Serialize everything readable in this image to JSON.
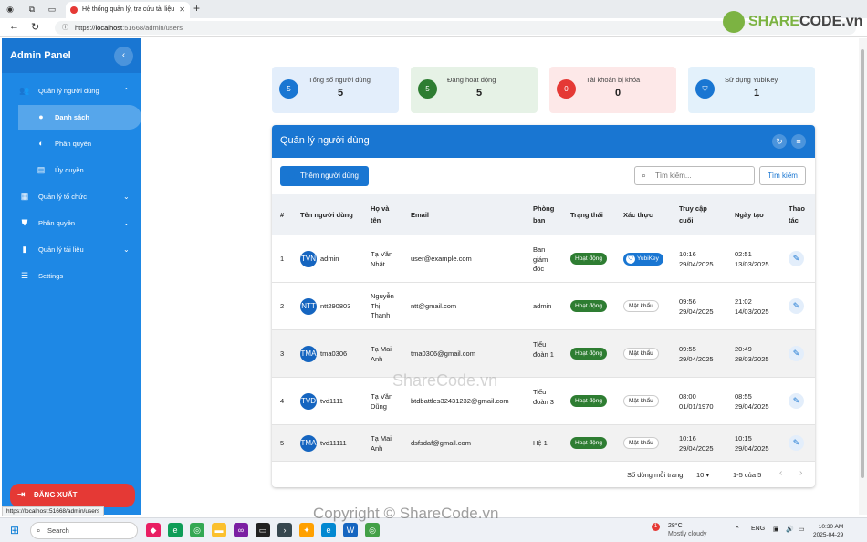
{
  "browser": {
    "tab_title": "Hệ thống quản lý, tra cứu tài liệu",
    "url_host": "localhost",
    "url_path": ":51668/admin/users",
    "status_url": "https://localhost:51668/admin/users"
  },
  "sidebar": {
    "title": "Admin Panel",
    "items": [
      {
        "label": "Quản lý người dùng",
        "icon": "users-icon",
        "expanded": true
      },
      {
        "label": "Danh sách",
        "icon": "account-circle-icon",
        "active": true
      },
      {
        "label": "Phân quyền",
        "icon": "account-settings-icon"
      },
      {
        "label": "Ủy quyền",
        "icon": "clipboard-icon"
      },
      {
        "label": "Quản lý tổ chức",
        "icon": "building-icon"
      },
      {
        "label": "Phân quyền",
        "icon": "shield-icon"
      },
      {
        "label": "Quản lý tài liệu",
        "icon": "document-icon"
      },
      {
        "label": "Settings",
        "icon": "sliders-icon"
      }
    ],
    "logout_label": "ĐĂNG XUẤT"
  },
  "stats": [
    {
      "label": "Tổng số người dùng",
      "value": "5",
      "badge": "5",
      "color": "#1976d2",
      "bg": "#e3eefb"
    },
    {
      "label": "Đang hoạt động",
      "value": "5",
      "badge": "5",
      "color": "#2e7d32",
      "bg": "#e6f2e6"
    },
    {
      "label": "Tài khoản bị khóa",
      "value": "0",
      "badge": "0",
      "color": "#e53935",
      "bg": "#fde8e8"
    },
    {
      "label": "Sử dụng YubiKey",
      "value": "1",
      "badge": "",
      "color": "#1976d2",
      "bg": "#e3f1fb"
    }
  ],
  "card": {
    "title": "Quản lý người dùng",
    "add_button": "Thêm người dùng",
    "search_placeholder": "Tìm kiếm...",
    "search_button": "Tìm kiếm"
  },
  "table": {
    "headers": [
      "#",
      "Tên người dùng",
      "Họ và tên",
      "Email",
      "Phòng ban",
      "Trạng thái",
      "Xác thực",
      "Truy cập cuối",
      "Ngày tạo",
      "Thao tác"
    ],
    "rows": [
      {
        "num": "1",
        "avatar": "TVN",
        "username": "admin",
        "fullname": "Tạ Văn Nhật",
        "email": "user@example.com",
        "dept": "Ban giám đốc",
        "status": "Hoạt động",
        "auth": "YubiKey",
        "last_access": "10:16 29/04/2025",
        "created": "02:51 13/03/2025"
      },
      {
        "num": "2",
        "avatar": "NTT",
        "username": "ntt290803",
        "fullname": "Nguyễn Thị Thanh",
        "email": "ntt@gmail.com",
        "dept": "admin",
        "status": "Hoạt động",
        "auth": "Mật khẩu",
        "last_access": "09:56 29/04/2025",
        "created": "21:02 14/03/2025"
      },
      {
        "num": "3",
        "avatar": "TMA",
        "username": "tma0306",
        "fullname": "Tạ Mai Anh",
        "email": "tma0306@gmail.com",
        "dept": "Tiểu đoàn 1",
        "status": "Hoạt động",
        "auth": "Mật khẩu",
        "last_access": "09:55 29/04/2025",
        "created": "20:49 28/03/2025"
      },
      {
        "num": "4",
        "avatar": "TVD",
        "username": "tvd1111",
        "fullname": "Tạ Văn Dũng",
        "email": "btdbattles32431232@gmail.com",
        "dept": "Tiểu đoàn 3",
        "status": "Hoạt động",
        "auth": "Mật khẩu",
        "last_access": "08:00 01/01/1970",
        "created": "08:55 29/04/2025"
      },
      {
        "num": "5",
        "avatar": "TMA",
        "username": "tvd11111",
        "fullname": "Tạ Mai Anh",
        "email": "dsfsdaf@gmail.com",
        "dept": "Hệ 1",
        "status": "Hoạt động",
        "auth": "Mật khẩu",
        "last_access": "10:16 29/04/2025",
        "created": "10:15 29/04/2025"
      }
    ]
  },
  "pagination": {
    "rows_per_page_label": "Số dòng mỗi trang:",
    "rows_per_page": "10",
    "range": "1-5 của 5"
  },
  "taskbar": {
    "search_label": "Search",
    "temperature": "28°C",
    "weather": "Mostly cloudy",
    "weather_badge": "1",
    "lang": "ENG",
    "time": "10:30 AM",
    "date": "2025-04-29"
  },
  "watermark": {
    "logo_text_a": "SHARE",
    "logo_text_b": "CODE",
    "logo_text_c": ".vn",
    "copyright": "Copyright © ShareCode.vn",
    "center": "ShareCode.vn"
  }
}
